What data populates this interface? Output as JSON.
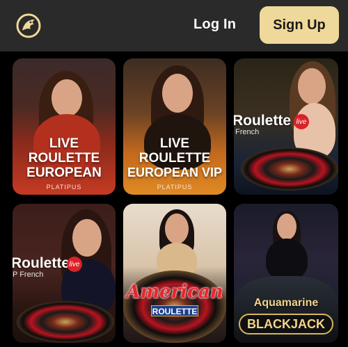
{
  "header": {
    "logo_icon": "dragon-logo-icon",
    "login_label": "Log In",
    "signup_label": "Sign Up",
    "accent_color": "#efd99a"
  },
  "games": [
    {
      "title_lines": [
        "LIVE",
        "ROULETTE",
        "EUROPEAN"
      ],
      "provider": "PLATIPUS"
    },
    {
      "title_lines": [
        "LIVE",
        "ROULETTE",
        "EUROPEAN VIP"
      ],
      "provider": "PLATIPUS"
    },
    {
      "title": "Roulette",
      "badge": "live",
      "subtitle": "French"
    },
    {
      "title": "Roulette",
      "badge": "live",
      "subtitle": "P French"
    },
    {
      "title": "American",
      "subtitle": "ROULETTE"
    },
    {
      "title": "Aquamarine",
      "subtitle": "BLACKJACK"
    }
  ]
}
